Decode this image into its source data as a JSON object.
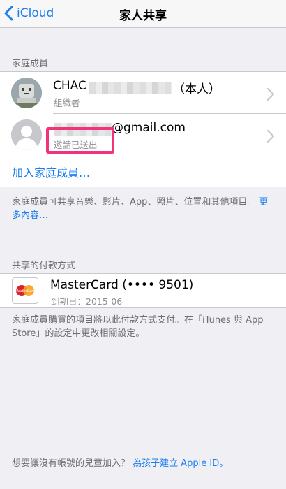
{
  "nav": {
    "back_label": "iCloud",
    "title": "家人共享"
  },
  "family": {
    "header": "家庭成員",
    "members": [
      {
        "name_prefix": "CHAC",
        "name_suffix": "（本人）",
        "role": "組織者"
      },
      {
        "email_suffix": "@gmail.com",
        "status": "邀請已送出"
      }
    ],
    "add_label": "加入家庭成員…"
  },
  "family_note": {
    "text": "家庭成員可共享音樂、影片、App、照片、位置和其他項目。",
    "more_link": "更多內容…"
  },
  "payment": {
    "header": "共享的付款方式",
    "card_name": "MasterCard (•••• 9501)",
    "expiry": "到期日：2015-06",
    "card_logo_text": "MasterCard"
  },
  "payment_note": {
    "text": "家庭成員購買的項目將以此付款方式支付。在「iTunes 與 App Store」的設定中更改相關設定。"
  },
  "footer": {
    "text": "想要讓沒有帳號的兒童加入？",
    "link": "為孩子建立 Apple ID。"
  },
  "colors": {
    "accent": "#1a7ef0",
    "highlight": "#f0337a",
    "background": "#efeff4"
  }
}
